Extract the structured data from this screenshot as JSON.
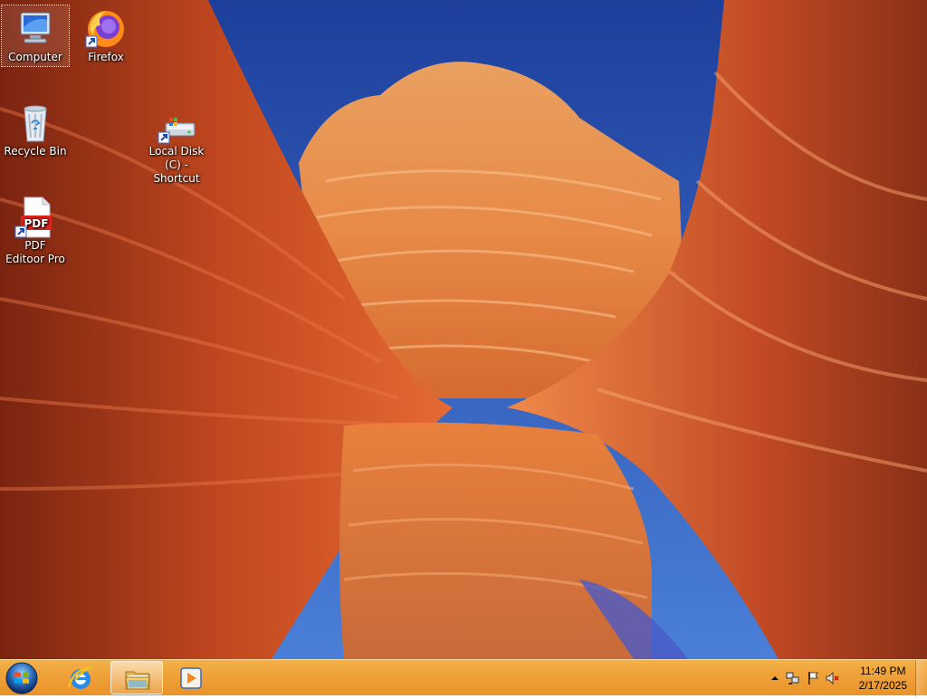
{
  "desktop": {
    "icons": [
      {
        "label": "Computer",
        "icon": "computer-icon"
      },
      {
        "label": "Firefox",
        "icon": "firefox-icon"
      },
      {
        "label": "Recycle Bin",
        "icon": "recycle-bin-icon"
      },
      {
        "label": "Local Disk (C) - Shortcut",
        "icon": "drive-icon"
      },
      {
        "label": "PDF Editoor Pro",
        "icon": "pdf-icon"
      }
    ]
  },
  "taskbar": {
    "start": {
      "icon": "windows-start-icon"
    },
    "pinned": [
      {
        "icon": "internet-explorer-icon"
      },
      {
        "icon": "file-explorer-icon"
      },
      {
        "icon": "media-player-icon"
      }
    ],
    "tray": {
      "icons": [
        "show-hidden-icons-icon",
        "network-icon",
        "action-center-flag-icon",
        "volume-muted-icon"
      ],
      "time": "11:49 PM",
      "date": "2/17/2025"
    }
  },
  "colors": {
    "taskbar": "#f0a23a",
    "sky": "#2a55b8",
    "rock": "#d25a2a"
  }
}
